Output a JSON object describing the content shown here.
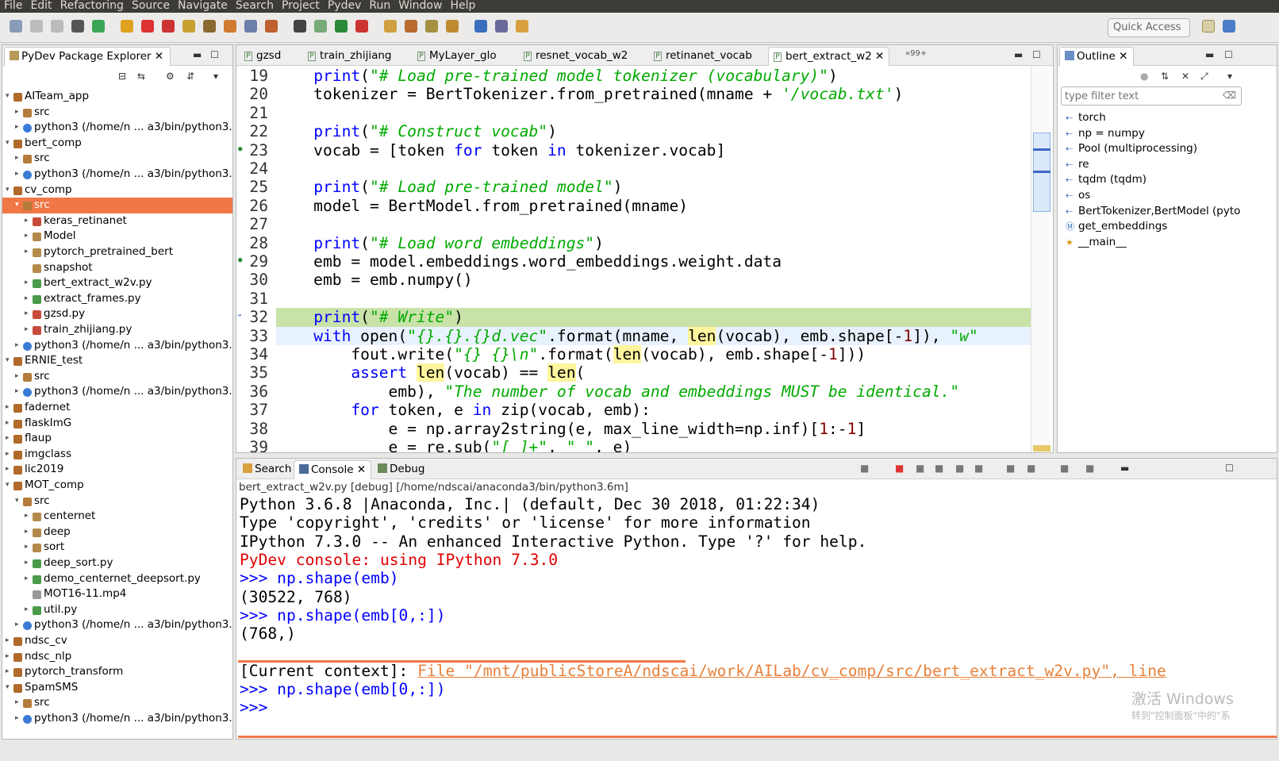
{
  "menu": [
    "File",
    "Edit",
    "Refactoring",
    "Source",
    "Navigate",
    "Search",
    "Project",
    "Pydev",
    "Run",
    "Window",
    "Help"
  ],
  "toolbar": {
    "quick_access": "Quick Access"
  },
  "explorer": {
    "title": "PyDev Package Explorer",
    "items": [
      {
        "label": "AITeam_app",
        "depth": 0,
        "arrow": "▾",
        "kind": "project"
      },
      {
        "label": "src",
        "depth": 1,
        "arrow": "▸",
        "kind": "src"
      },
      {
        "label": "python3  (/home/n ... a3/bin/python3.",
        "depth": 1,
        "arrow": "▸",
        "kind": "python"
      },
      {
        "label": "bert_comp",
        "depth": 0,
        "arrow": "▾",
        "kind": "project"
      },
      {
        "label": "src",
        "depth": 1,
        "arrow": "▸",
        "kind": "src"
      },
      {
        "label": "python3  (/home/n ... a3/bin/python3.",
        "depth": 1,
        "arrow": "▸",
        "kind": "python"
      },
      {
        "label": "cv_comp",
        "depth": 0,
        "arrow": "▾",
        "kind": "project"
      },
      {
        "label": "src",
        "depth": 1,
        "arrow": "▾",
        "kind": "src",
        "selected": true
      },
      {
        "label": "keras_retinanet",
        "depth": 2,
        "arrow": "▸",
        "kind": "pkg-err"
      },
      {
        "label": "Model",
        "depth": 2,
        "arrow": "▸",
        "kind": "pkg"
      },
      {
        "label": "pytorch_pretrained_bert",
        "depth": 2,
        "arrow": "▸",
        "kind": "pkg"
      },
      {
        "label": "snapshot",
        "depth": 2,
        "arrow": "",
        "kind": "pkg"
      },
      {
        "label": "bert_extract_w2v.py",
        "depth": 2,
        "arrow": "▸",
        "kind": "file"
      },
      {
        "label": "extract_frames.py",
        "depth": 2,
        "arrow": "▸",
        "kind": "file"
      },
      {
        "label": "gzsd.py",
        "depth": 2,
        "arrow": "▸",
        "kind": "file-err"
      },
      {
        "label": "train_zhijiang.py",
        "depth": 2,
        "arrow": "▸",
        "kind": "file-err"
      },
      {
        "label": "python3  (/home/n ... a3/bin/python3.",
        "depth": 1,
        "arrow": "▸",
        "kind": "python"
      },
      {
        "label": "ERNIE_test",
        "depth": 0,
        "arrow": "▾",
        "kind": "project"
      },
      {
        "label": "src",
        "depth": 1,
        "arrow": "▸",
        "kind": "src"
      },
      {
        "label": "python3  (/home/n ... a3/bin/python3.",
        "depth": 1,
        "arrow": "▸",
        "kind": "python"
      },
      {
        "label": "fadernet",
        "depth": 0,
        "arrow": "▸",
        "kind": "project"
      },
      {
        "label": "flaskImG",
        "depth": 0,
        "arrow": "▸",
        "kind": "project"
      },
      {
        "label": "flaup",
        "depth": 0,
        "arrow": "▸",
        "kind": "project"
      },
      {
        "label": "imgclass",
        "depth": 0,
        "arrow": "▸",
        "kind": "project"
      },
      {
        "label": "lic2019",
        "depth": 0,
        "arrow": "▸",
        "kind": "project"
      },
      {
        "label": "MOT_comp",
        "depth": 0,
        "arrow": "▾",
        "kind": "project"
      },
      {
        "label": "src",
        "depth": 1,
        "arrow": "▾",
        "kind": "src"
      },
      {
        "label": "centernet",
        "depth": 2,
        "arrow": "▸",
        "kind": "pkg"
      },
      {
        "label": "deep",
        "depth": 2,
        "arrow": "▸",
        "kind": "pkg"
      },
      {
        "label": "sort",
        "depth": 2,
        "arrow": "▸",
        "kind": "pkg"
      },
      {
        "label": "deep_sort.py",
        "depth": 2,
        "arrow": "▸",
        "kind": "file"
      },
      {
        "label": "demo_centernet_deepsort.py",
        "depth": 2,
        "arrow": "▸",
        "kind": "file"
      },
      {
        "label": "MOT16-11.mp4",
        "depth": 2,
        "arrow": "",
        "kind": "plain"
      },
      {
        "label": "util.py",
        "depth": 2,
        "arrow": "▸",
        "kind": "file"
      },
      {
        "label": "python3  (/home/n ... a3/bin/python3.",
        "depth": 1,
        "arrow": "▸",
        "kind": "python"
      },
      {
        "label": "ndsc_cv",
        "depth": 0,
        "arrow": "▸",
        "kind": "project"
      },
      {
        "label": "ndsc_nlp",
        "depth": 0,
        "arrow": "▸",
        "kind": "project"
      },
      {
        "label": "pytorch_transform",
        "depth": 0,
        "arrow": "▸",
        "kind": "project"
      },
      {
        "label": "SpamSMS",
        "depth": 0,
        "arrow": "▾",
        "kind": "project"
      },
      {
        "label": "src",
        "depth": 1,
        "arrow": "▸",
        "kind": "src"
      },
      {
        "label": "python3  (/home/n ... a3/bin/python3.",
        "depth": 1,
        "arrow": "▸",
        "kind": "python"
      }
    ]
  },
  "editor": {
    "tabs": [
      "gzsd",
      "train_zhijiang",
      "MyLayer_glo",
      "resnet_vocab_w2",
      "retinanet_vocab",
      "bert_extract_w2"
    ],
    "active_tab": 5,
    "overflow": "»99+",
    "lines": [
      {
        "n": "19",
        "segs": [
          [
            "    ",
            ""
          ],
          [
            "print",
            "k"
          ],
          [
            "(",
            ""
          ],
          [
            "\"# Load pre-trained model tokenizer (vocabulary)\"",
            "s"
          ],
          [
            ")",
            ""
          ]
        ]
      },
      {
        "n": "20",
        "segs": [
          [
            "    tokenizer = BertTokenizer.from_pretrained(mname + ",
            ""
          ],
          [
            "'/vocab.txt'",
            "s"
          ],
          [
            ")",
            ""
          ]
        ]
      },
      {
        "n": "21",
        "segs": [
          [
            "",
            ""
          ]
        ]
      },
      {
        "n": "22",
        "segs": [
          [
            "    ",
            ""
          ],
          [
            "print",
            "k"
          ],
          [
            "(",
            ""
          ],
          [
            "\"# Construct vocab\"",
            "s"
          ],
          [
            ")",
            ""
          ]
        ]
      },
      {
        "n": "23",
        "segs": [
          [
            "    vocab = [token ",
            ""
          ],
          [
            "for",
            "k"
          ],
          [
            " token ",
            ""
          ],
          [
            "in",
            "k"
          ],
          [
            " tokenizer.vocab]",
            ""
          ]
        ]
      },
      {
        "n": "24",
        "segs": [
          [
            "",
            ""
          ]
        ]
      },
      {
        "n": "25",
        "segs": [
          [
            "    ",
            ""
          ],
          [
            "print",
            "k"
          ],
          [
            "(",
            ""
          ],
          [
            "\"# Load pre-trained model\"",
            "s"
          ],
          [
            ")",
            ""
          ]
        ]
      },
      {
        "n": "26",
        "segs": [
          [
            "    model = BertModel.from_pretrained(mname)",
            ""
          ]
        ]
      },
      {
        "n": "27",
        "segs": [
          [
            "",
            ""
          ]
        ]
      },
      {
        "n": "28",
        "segs": [
          [
            "    ",
            ""
          ],
          [
            "print",
            "k"
          ],
          [
            "(",
            ""
          ],
          [
            "\"# Load word embeddings\"",
            "s"
          ],
          [
            ")",
            ""
          ]
        ]
      },
      {
        "n": "29",
        "segs": [
          [
            "    emb = model.embeddings.word_embeddings.weight.data",
            ""
          ]
        ]
      },
      {
        "n": "30",
        "segs": [
          [
            "    emb = emb.numpy()",
            ""
          ]
        ]
      },
      {
        "n": "31",
        "segs": [
          [
            "",
            ""
          ]
        ]
      },
      {
        "n": "32",
        "segs": [
          [
            "    ",
            ""
          ],
          [
            "print",
            "k"
          ],
          [
            "(",
            ""
          ],
          [
            "\"# Write\"",
            "s"
          ],
          [
            ")",
            ""
          ]
        ],
        "bg": "#c9e2a8"
      },
      {
        "n": "33",
        "segs": [
          [
            "    ",
            ""
          ],
          [
            "with",
            "k"
          ],
          [
            " open(",
            ""
          ],
          [
            "\"{}.{}.{}d.vec\"",
            "s"
          ],
          [
            ".format(mname, ",
            ""
          ],
          [
            "len",
            "hl"
          ],
          [
            "(vocab), emb.shape[-",
            ""
          ],
          [
            "1",
            "n"
          ],
          [
            "]), ",
            ""
          ],
          [
            "\"w\"",
            "s"
          ]
        ],
        "bg": "#e8f2fe"
      },
      {
        "n": "34",
        "segs": [
          [
            "        fout.write(",
            ""
          ],
          [
            "\"{} {}\\n\"",
            "s"
          ],
          [
            ".format(",
            ""
          ],
          [
            "len",
            "hl"
          ],
          [
            "(vocab), emb.shape[-",
            ""
          ],
          [
            "1",
            "n"
          ],
          [
            "]))",
            ""
          ]
        ]
      },
      {
        "n": "35",
        "segs": [
          [
            "        ",
            ""
          ],
          [
            "assert",
            "k"
          ],
          [
            " ",
            ""
          ],
          [
            "len",
            "hl"
          ],
          [
            "(vocab) == ",
            ""
          ],
          [
            "len",
            "hl"
          ],
          [
            "(",
            ""
          ]
        ]
      },
      {
        "n": "36",
        "segs": [
          [
            "            emb), ",
            ""
          ],
          [
            "\"The number of vocab and embeddings MUST be identical.\"",
            "s"
          ]
        ]
      },
      {
        "n": "37",
        "segs": [
          [
            "        ",
            ""
          ],
          [
            "for",
            "k"
          ],
          [
            " token, e ",
            ""
          ],
          [
            "in",
            "k"
          ],
          [
            " zip(vocab, emb):",
            ""
          ]
        ]
      },
      {
        "n": "38",
        "segs": [
          [
            "            e = np.array2string(e, max_line_width=np.inf)[",
            ""
          ],
          [
            "1",
            "n"
          ],
          [
            ":-",
            ""
          ],
          [
            "1",
            "n"
          ],
          [
            "]",
            ""
          ]
        ]
      },
      {
        "n": "39",
        "segs": [
          [
            "            e = re.sub(",
            ""
          ],
          [
            "\"[ ]+\"",
            "s"
          ],
          [
            ", ",
            ""
          ],
          [
            "\" \"",
            "s"
          ],
          [
            ", e)",
            ""
          ]
        ]
      }
    ]
  },
  "outline": {
    "title": "Outline",
    "filter_placeholder": "type filter text",
    "items": [
      "torch",
      "np = numpy",
      "Pool (multiprocessing)",
      "re",
      "tqdm (tqdm)",
      "os",
      "BertTokenizer,BertModel (pyto",
      "get_embeddings",
      "__main__"
    ]
  },
  "console": {
    "tabs": [
      "Search",
      "Console",
      "Debug"
    ],
    "active_tab": 1,
    "header": "bert_extract_w2v.py [debug] [/home/ndscai/anaconda3/bin/python3.6m]",
    "lines": [
      {
        "text": "Python 3.6.8 |Anaconda, Inc.| (default, Dec 30 2018, 01:22:34)",
        "color": "#000000"
      },
      {
        "text": "Type 'copyright', 'credits' or 'license' for more information",
        "color": "#000000"
      },
      {
        "text": "IPython 7.3.0 -- An enhanced Interactive Python. Type '?' for help.",
        "color": "#000000"
      },
      {
        "text": "PyDev console: using IPython 7.3.0",
        "color": "#e00000"
      },
      {
        "text": ">>> np.shape(emb)",
        "color": "#0000ff"
      },
      {
        "text": "(30522, 768)",
        "color": "#000000"
      },
      {
        "text": ">>> np.shape(emb[0,:])",
        "color": "#0000ff"
      },
      {
        "text": "(768,)",
        "color": "#000000"
      },
      {
        "text": "",
        "color": "#000000"
      },
      {
        "text": "[Current context]: ",
        "color": "#000000",
        "link": "File \"/mnt/publicStoreA/ndscai/work/AILab/cv_comp/src/bert_extract_w2v.py\", line"
      },
      {
        "text": ">>> np.shape(emb[0,:])",
        "color": "#0000ff"
      },
      {
        "text": ">>> ",
        "color": "#0000ff"
      }
    ],
    "watermark_line1": "激活 Windows",
    "watermark_line2": "转到\"控制面板\"中的\"系"
  }
}
